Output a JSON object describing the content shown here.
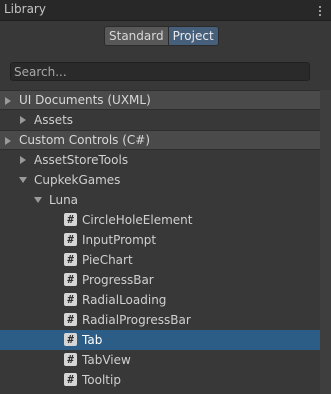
{
  "window": {
    "title": "Library"
  },
  "icons": {
    "menu": "vertical-dots-icon",
    "collapsed": "triangle-right-icon",
    "expanded": "triangle-down-icon",
    "element": "hash-icon"
  },
  "toggle": {
    "standard_label": "Standard",
    "project_label": "Project",
    "selected": "Project"
  },
  "search": {
    "placeholder": "Search...",
    "value": ""
  },
  "colors": {
    "selected_row": "#2c5d87",
    "toggle_active": "#46607c",
    "panel_bg": "#383838"
  },
  "tree": {
    "ui_documents": "UI Documents (UXML)",
    "assets": "Assets",
    "custom_controls": "Custom Controls (C#)",
    "assetstoretools": "AssetStoreTools",
    "cupkekgames": "CupkekGames",
    "luna": "Luna",
    "elements": [
      "CircleHoleElement",
      "InputPrompt",
      "PieChart",
      "ProgressBar",
      "RadialLoading",
      "RadialProgressBar",
      "Tab",
      "TabView",
      "Tooltip"
    ],
    "selected": "Tab"
  }
}
